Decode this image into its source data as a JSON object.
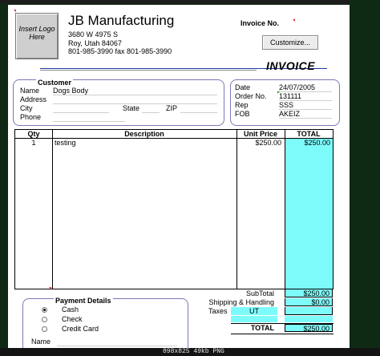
{
  "header": {
    "logo_text": "Insert Logo Here",
    "company_name": "JB Manufacturing",
    "address1": "3680 W 4975 S",
    "address2": "Roy, Utah  84067",
    "phone_fax": "801-985-3990 fax 801-985-3990",
    "invoice_no_label": "Invoice No.",
    "customize_button": "Customize...",
    "title": "INVOICE"
  },
  "customer": {
    "section_label": "Customer",
    "name_label": "Name",
    "name_value": "Dogs Body",
    "address_label": "Address",
    "city_label": "City",
    "state_label": "State",
    "zip_label": "ZIP",
    "phone_label": "Phone"
  },
  "meta": {
    "date_label": "Date",
    "date_value": "24/07/2005",
    "order_no_label": "Order No.",
    "order_no_value": "131111",
    "rep_label": "Rep",
    "rep_value": "SSS",
    "fob_label": "FOB",
    "fob_value": "AKEIZ"
  },
  "items": {
    "headers": {
      "qty": "Qty",
      "description": "Description",
      "unit_price": "Unit Price",
      "total": "TOTAL"
    },
    "rows": [
      {
        "qty": "1",
        "description": "testing",
        "unit_price": "$250.00",
        "total": "$250.00"
      }
    ]
  },
  "totals": {
    "subtotal_label": "SubTotal",
    "subtotal_value": "$250.00",
    "shipping_label": "Shipping & Handling",
    "shipping_value": "$0.00",
    "taxes_label": "Taxes",
    "taxes_state": "UT",
    "total_label": "TOTAL",
    "total_value": "$250.00"
  },
  "payment": {
    "section_label": "Payment Details",
    "options": [
      "Cash",
      "Check",
      "Credit Card"
    ],
    "selected": "Cash",
    "name_label": "Name"
  },
  "status_bar": {
    "caption": "898x825 49kb PNG"
  },
  "colors": {
    "accent_cyan": "#7dfbfb",
    "border_blue": "#7a78b8",
    "rule_blue": "#1f3ea6",
    "background_dark": "#0e2a14"
  }
}
